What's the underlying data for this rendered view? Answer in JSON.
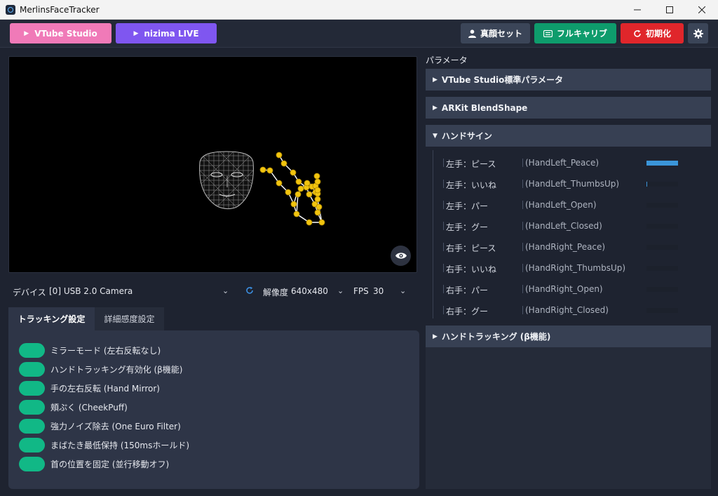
{
  "window": {
    "title": "MerlinsFaceTracker",
    "minimize": "—",
    "maximize": "☐",
    "close": "✕"
  },
  "toolbar": {
    "vtube_label": "VTube Studio",
    "nizima_label": "nizima LIVE",
    "face_set_label": "真顔セット",
    "full_calib_label": "フルキャリブ",
    "reset_label": "初期化"
  },
  "device": {
    "label": "デバイス",
    "value": "[0] USB 2.0 Camera",
    "resolution_label": "解像度",
    "resolution_value": "640x480",
    "fps_label": "FPS",
    "fps_value": "30"
  },
  "tabs": {
    "tracking": "トラッキング設定",
    "sensitivity": "詳細感度設定"
  },
  "toggles": [
    {
      "label": "ミラーモード (左右反転なし)",
      "on": true
    },
    {
      "label": "ハンドトラッキング有効化 (β機能)",
      "on": true
    },
    {
      "label": "手の左右反転 (Hand Mirror)",
      "on": true
    },
    {
      "label": "頬ぷく (CheekPuff)",
      "on": true
    },
    {
      "label": "強力ノイズ除去 (One Euro Filter)",
      "on": true
    },
    {
      "label": "まばたき最低保持 (150msホールド)",
      "on": true
    },
    {
      "label": "首の位置を固定 (並行移動オフ)",
      "on": true
    }
  ],
  "params": {
    "title": "パラメータ",
    "sections": {
      "vtube": "VTube Studio標準パラメータ",
      "arkit": "ARKit BlendShape",
      "handsign": "ハンドサイン",
      "handtracking": "ハンドトラッキング (β機能)"
    },
    "handsigns": [
      {
        "jp": "左手：ピース",
        "en": "(HandLeft_Peace)",
        "value": 1.0
      },
      {
        "jp": "左手：いいね",
        "en": "(HandLeft_ThumbsUp)",
        "value": 0.02
      },
      {
        "jp": "左手：パー",
        "en": "(HandLeft_Open)",
        "value": 0
      },
      {
        "jp": "左手：グー",
        "en": "(HandLeft_Closed)",
        "value": 0
      },
      {
        "jp": "右手：ピース",
        "en": "(HandRight_Peace)",
        "value": 0
      },
      {
        "jp": "右手：いいね",
        "en": "(HandRight_ThumbsUp)",
        "value": 0
      },
      {
        "jp": "右手：パー",
        "en": "(HandRight_Open)",
        "value": 0
      },
      {
        "jp": "右手：グー",
        "en": "(HandRight_Closed)",
        "value": 0
      }
    ]
  },
  "colors": {
    "accent_toggle": "#11b886",
    "vtube": "#f07ab8",
    "nizima": "#7f56f0",
    "calib": "#0e9c6c",
    "reset": "#e0262b",
    "bar": "#3b95d9"
  }
}
